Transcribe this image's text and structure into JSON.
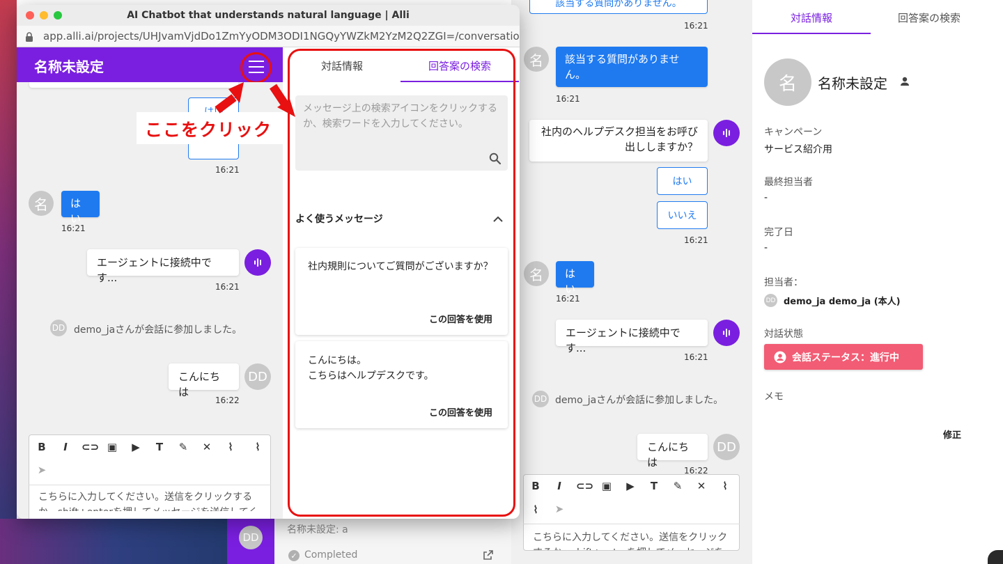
{
  "popup": {
    "window_title": "AI Chatbot that understands natural language | Alli",
    "url": "app.alli.ai/projects/UHJvamVjdDo1ZmYyODM3ODI1NGQyYWZkM2YzM2Q2ZGI=/conversation...",
    "app_title": "名称未設定",
    "annotation_label": "ここをクリック",
    "chat": {
      "partial_button": "はい",
      "time1": "16:21",
      "user_avatar": "名",
      "user_msg": "はい",
      "time2": "16:21",
      "bot_msg": "エージェントに接続中です...",
      "time3": "16:21",
      "join_avatar": "DD",
      "join_msg": "demo_jaさんが会話に参加しました。",
      "agent_msg": "こんにちは",
      "agent_avatar": "DD",
      "time4": "16:22",
      "editor_placeholder": "こちらに入力してください。送信をクリックするか、shift+enterを押してメッセージを送信してください。"
    },
    "right_panel": {
      "tab_info": "対話情報",
      "tab_search": "回答案の検索",
      "search_placeholder": "メッセージ上の検索アイコンをクリックするか、検索ワードを入力してください。",
      "frequent_header": "よく使うメッセージ",
      "cards": [
        {
          "text": "社内規則についてご質問がございますか？",
          "use": "この回答を使用"
        },
        {
          "text_line1": "こんにちは。",
          "text_line2": "こちらはヘルプデスクです。",
          "use": "この回答を使用"
        }
      ]
    }
  },
  "background": {
    "list_label": "名称未設定: a",
    "completed": "Completed",
    "list_avatar": "DD",
    "chat": {
      "top_partial_btn": "該当する質問がありません。",
      "time1": "16:21",
      "user_avatar1": "名",
      "user_msg1": "該当する質問がありませ\nん。",
      "time2": "16:21",
      "bot_msg1_line1": "社内のヘルプデスク担当をお呼び",
      "bot_msg1_line2": "出ししますか？",
      "btn_yes": "はい",
      "btn_no": "いいえ",
      "time3": "16:21",
      "user_avatar2": "名",
      "user_msg2": "はい",
      "time4": "16:21",
      "bot_msg2": "エージェントに接続中です...",
      "time5": "16:21",
      "join_avatar": "DD",
      "join_msg": "demo_jaさんが会話に参加しました。",
      "agent_msg": "こんにちは",
      "agent_avatar": "DD",
      "time6": "16:22",
      "editor_placeholder": "こちらに入力してください。送信をクリックするか、shift+enterを押してメッセージを送信してください。"
    },
    "sidebar": {
      "tab_info": "対話情報",
      "tab_search": "回答案の検索",
      "avatar": "名",
      "name": "名称未設定",
      "campaign_label": "キャンペーン",
      "campaign_value": "サービス紹介用",
      "last_agent_label": "最終担当者",
      "last_agent_value": "-",
      "completed_label": "完了日",
      "completed_value": "-",
      "assignee_label": "担当者：",
      "assignee_avatar": "DD",
      "assignee_value": "demo_ja demo_ja (本人)",
      "status_label": "対話状態",
      "status_badge": "会話ステータス：進行中",
      "memo_label": "メモ",
      "edit": "修正"
    }
  },
  "colors": {
    "brand_purple": "#7a1fe0",
    "message_blue": "#1f7af0",
    "annotation_red": "#e81010",
    "status_pink": "#f25c74"
  },
  "icons": [
    "lock-icon",
    "menu-icon",
    "search-icon",
    "chevron-up-icon",
    "bold-icon",
    "italic-icon",
    "link-icon",
    "image-icon",
    "video-icon",
    "text-size-icon",
    "eyedropper-icon",
    "clear-format-icon",
    "attachment-icon",
    "send-icon",
    "user-icon",
    "check-circle-icon",
    "open-external-icon",
    "account-circle-icon",
    "arrow-annotation"
  ]
}
